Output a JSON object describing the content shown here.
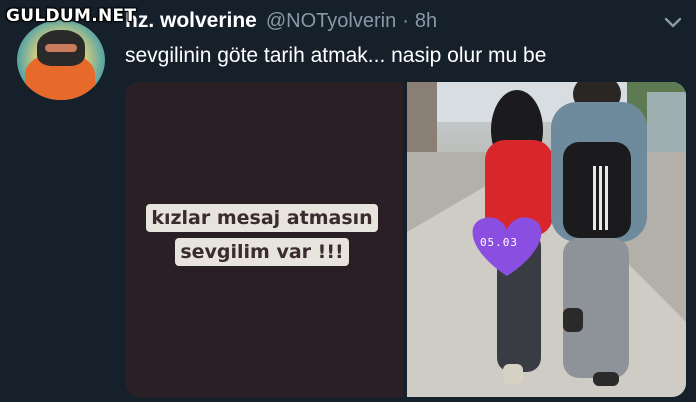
{
  "watermark": "GULDUM.NET",
  "tweet": {
    "display_name": "hz. wolverine",
    "handle": "@NOTyolverin",
    "separator": "·",
    "time": "8h",
    "text": "sevgilinin göte tarih atmak... nasip olur mu be"
  },
  "media": {
    "left_caption_line1": "kızlar mesaj atmasın",
    "left_caption_line2": "sevgilim var !!!",
    "right_heart_label": "05.03"
  },
  "icons": {
    "more": "chevron-down-icon",
    "avatar": "avatar"
  },
  "colors": {
    "background": "#15202b",
    "secondary_text": "#8899a6",
    "heart": "#8a4fe0"
  }
}
